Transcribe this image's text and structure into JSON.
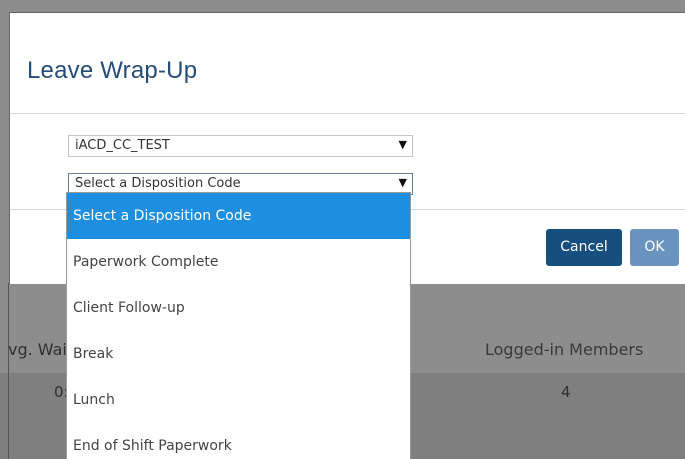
{
  "background": {
    "columns": [
      "vg. Wai",
      "Logged-in Members"
    ],
    "values": [
      "0:",
      "4"
    ]
  },
  "modal": {
    "title": "Leave Wrap-Up",
    "queue_select": {
      "value": "iACD_CC_TEST",
      "arrow_icon": "triangle-down"
    },
    "disposition_select": {
      "value": "Select a Disposition Code",
      "arrow_icon": "triangle-down"
    },
    "cancel_label": "Cancel",
    "ok_label": "OK"
  },
  "dropdown": {
    "options": [
      "Select a Disposition Code",
      "Paperwork Complete",
      "Client Follow-up",
      "Break",
      "Lunch",
      "End of Shift Paperwork"
    ],
    "selected_index": 0
  },
  "colors": {
    "title": "#254d7a",
    "cancel_button": "#174e80",
    "ok_button": "#6a94bf",
    "selected_option": "#1e8fe0"
  }
}
